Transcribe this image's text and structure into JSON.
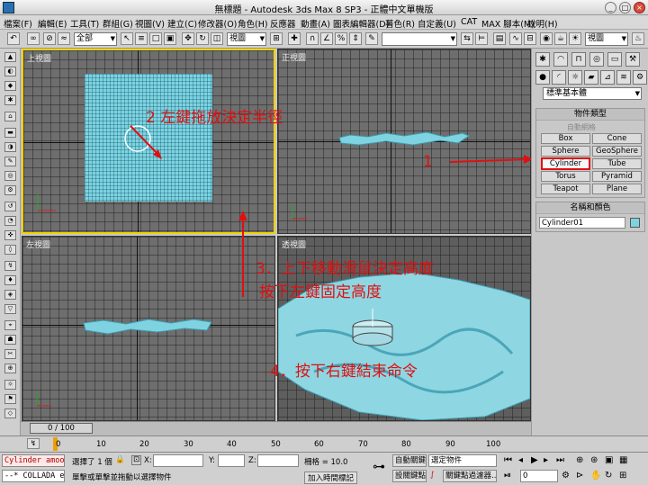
{
  "window": {
    "title": "無標題 - Autodesk 3ds Max 8 SP3 - 正體中文單機版"
  },
  "menu": [
    "檔案(F)",
    "編輯(E)",
    "工具(T)",
    "群組(G)",
    "視圖(V)",
    "建立(C)",
    "修改器(O)",
    "角色(H)",
    "反應器",
    "動畫(A)",
    "圖表編輯器(D)",
    "著色(R)",
    "自定義(U)",
    "CAT",
    "MAX 腳本(M)",
    "說明(H)"
  ],
  "toolbar": {
    "selection_filter": "全部",
    "ref_coord": "視圖",
    "view_dropdown": "視圖"
  },
  "viewports": {
    "top": "上視圖",
    "front": "正視圖",
    "left": "左視圖",
    "perspective": "透視圖"
  },
  "annotations": {
    "step1": "1",
    "step2": "2 左鍵拖放決定半徑",
    "step3a": "3．上下移動滑鼠決定高度",
    "step3b": "按下左鍵固定高度",
    "step4": "4．按下右鍵結束命令"
  },
  "command_panel": {
    "category": "標準基本體",
    "object_type_title": "物件類型",
    "autogrid": "自動網格",
    "buttons": [
      "Box",
      "Cone",
      "Sphere",
      "GeoSphere",
      "Cylinder",
      "Tube",
      "Torus",
      "Pyramid",
      "Teapot",
      "Plane"
    ],
    "name_color_title": "名稱和顏色",
    "object_name": "Cylinder01",
    "object_color": "#7fd3e0"
  },
  "timeline": {
    "slider": "0 / 100",
    "ticks": [
      "0",
      "10",
      "20",
      "30",
      "40",
      "50",
      "60",
      "70",
      "80",
      "90",
      "100"
    ]
  },
  "status": {
    "listener1": "Cylinder amoo",
    "listener2": "--* COLLADA e",
    "selected": "選擇了 1 個",
    "x_label": "X:",
    "y_label": "Y:",
    "z_label": "Z:",
    "grid": "柵格 = 10.0",
    "prompt": "單擊或單擊並拖動以選擇物件",
    "add_time_tag": "加入時間標記",
    "auto_key": "自動關鍵",
    "set_key": "設關鍵點",
    "selected_set": "選定物件",
    "key_filters": "關鍵點過濾器...",
    "frame": "0"
  }
}
